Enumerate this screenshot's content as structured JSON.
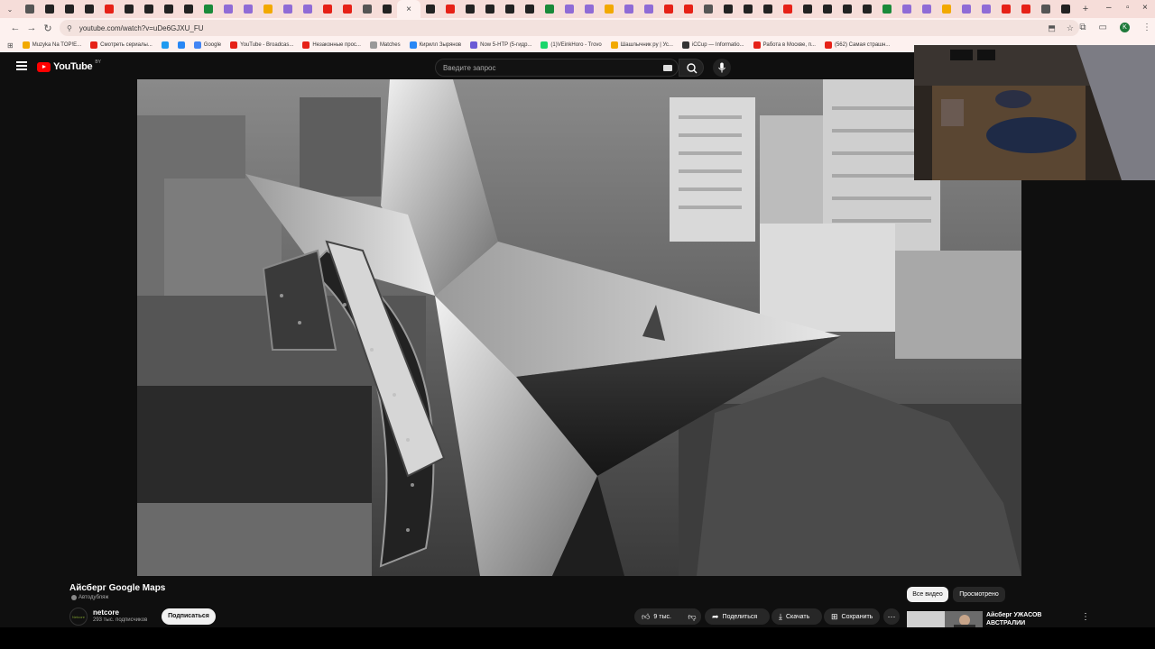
{
  "browser": {
    "tabs_count": 53,
    "active_tab_close": "×",
    "new_tab": "+",
    "url": "youtube.com/watch?v=uDe6GJXU_FU",
    "profile_initial": "K",
    "bookmarks": [
      {
        "label": "Muzyka Na TOP!E...",
        "color": "#f2a900"
      },
      {
        "label": "Смотреть сериалы...",
        "color": "#e62117"
      },
      {
        "label": "",
        "color": "#1d9bf0"
      },
      {
        "label": "",
        "color": "#2787f5"
      },
      {
        "label": "Google",
        "color": "#4285f4"
      },
      {
        "label": "YouTube - Broadcas...",
        "color": "#e62117"
      },
      {
        "label": "Незаконные прос...",
        "color": "#e62117"
      },
      {
        "label": "Matches",
        "color": "#999999"
      },
      {
        "label": "Кирилл Зырянов",
        "color": "#2787f5"
      },
      {
        "label": "Now 5-HTP (5-гидр...",
        "color": "#6b5bd6"
      },
      {
        "label": "(1)VEinkHoro - Trovo",
        "color": "#19d66b"
      },
      {
        "label": "Шашлычник ру | Ус...",
        "color": "#f2a900"
      },
      {
        "label": "iCCup — Informatio...",
        "color": "#333333"
      },
      {
        "label": "Работа в Москве, п...",
        "color": "#e62117"
      },
      {
        "label": "(562) Самая страшн...",
        "color": "#e62117"
      }
    ]
  },
  "youtube": {
    "logo_word": "YouTube",
    "logo_region": "BY",
    "search_placeholder": "Введите запрос",
    "video": {
      "title": "Айсберг Google Maps",
      "tag": "Автодубляж",
      "channel_name": "netcore",
      "channel_avatar_text": "Netcore",
      "subscribers": "293 тыс. подписчиков",
      "subscribe_label": "Подписаться",
      "likes": "9 тыс.",
      "share_label": "Поделиться",
      "download_label": "Скачать",
      "save_label": "Сохранить"
    },
    "chips": {
      "all": "Все видео",
      "watched": "Просмотрено"
    },
    "recommendation": {
      "title": "Айсберг УЖАСОВ АВСТРАЛИИ"
    }
  },
  "colors": {
    "brand_red": "#ff0000",
    "background": "#0f0f0f",
    "tab_strip": "#f6ddd9"
  }
}
